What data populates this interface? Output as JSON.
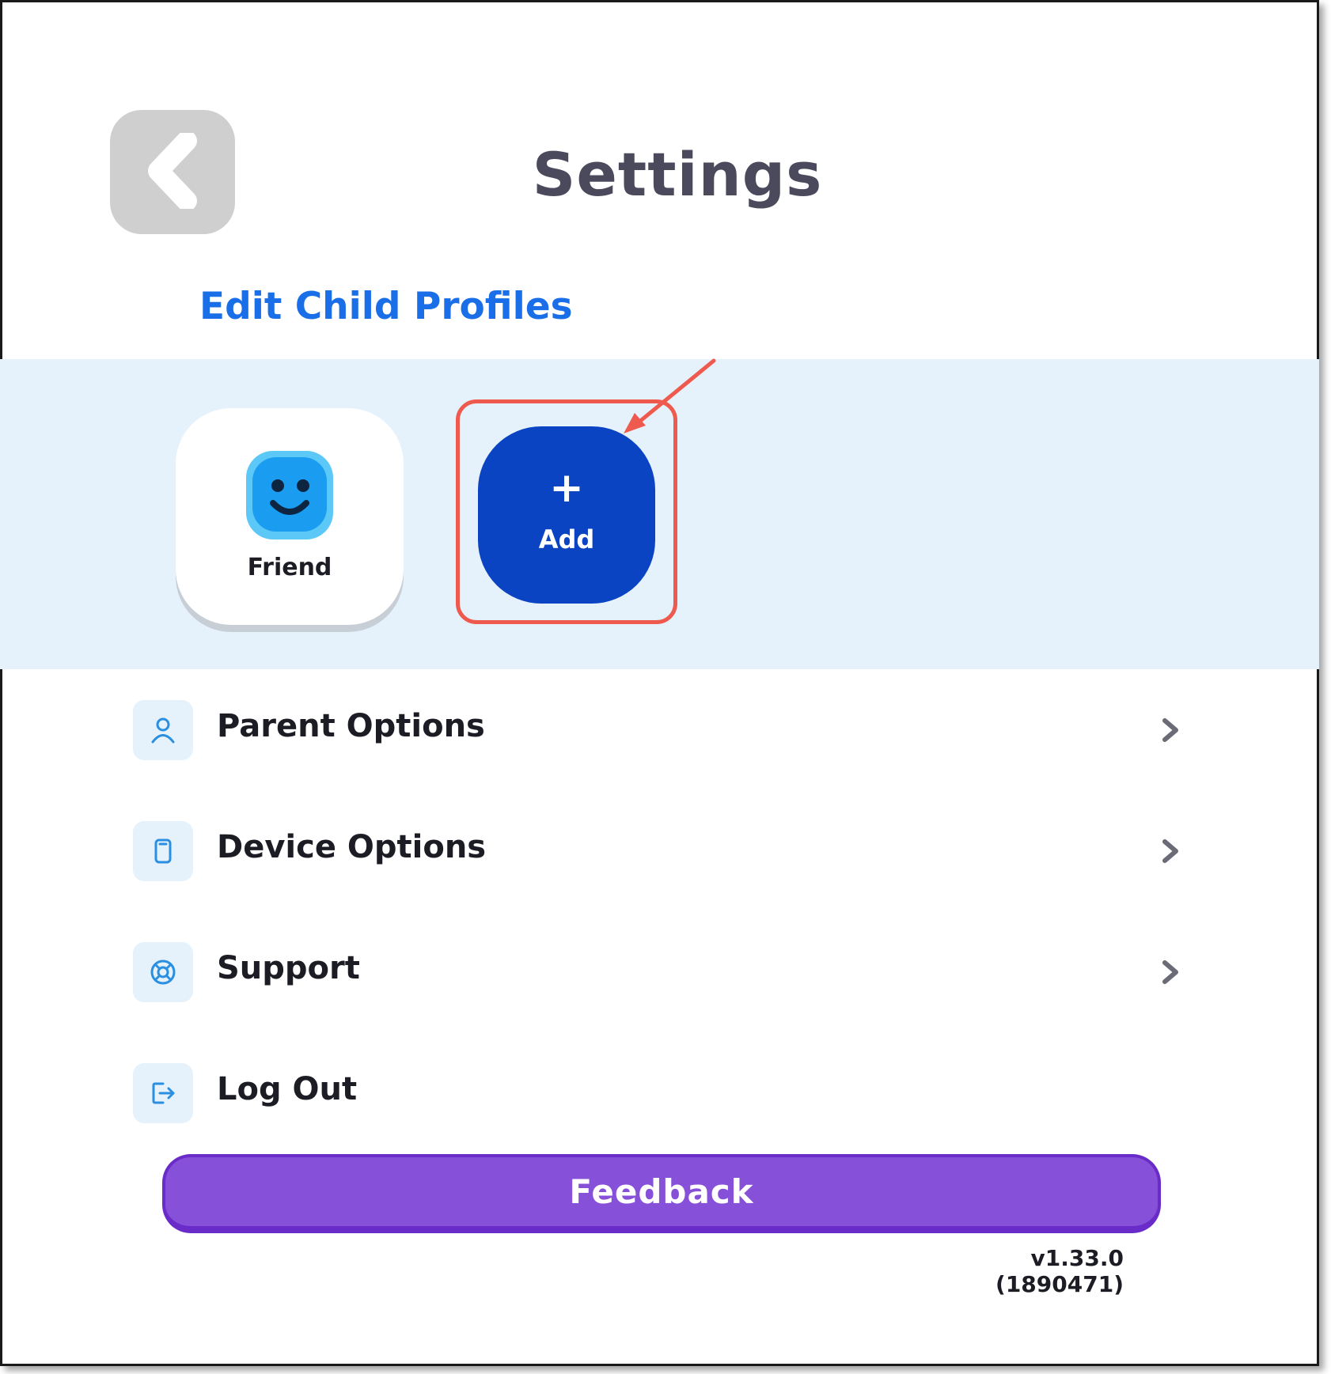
{
  "header": {
    "title": "Settings"
  },
  "profiles": {
    "section_title": "Edit Child Profiles",
    "items": [
      {
        "name": "Friend"
      }
    ],
    "add_button": {
      "icon": "+",
      "label": "Add"
    }
  },
  "menu": {
    "items": [
      {
        "label": "Parent Options",
        "icon": "person-icon",
        "has_chevron": true
      },
      {
        "label": "Device Options",
        "icon": "device-icon",
        "has_chevron": true
      },
      {
        "label": "Support",
        "icon": "lifebuoy-icon",
        "has_chevron": true
      },
      {
        "label": "Log Out",
        "icon": "logout-icon",
        "has_chevron": false
      }
    ]
  },
  "footer": {
    "feedback_label": "Feedback",
    "version": "v1.33.0 (1890471)"
  },
  "colors": {
    "accent_blue": "#1a6fe8",
    "add_button": "#0a44c2",
    "feedback_purple": "#8650d9",
    "band_background": "#e6f2fb",
    "annotation_red": "#ef5a4f"
  }
}
